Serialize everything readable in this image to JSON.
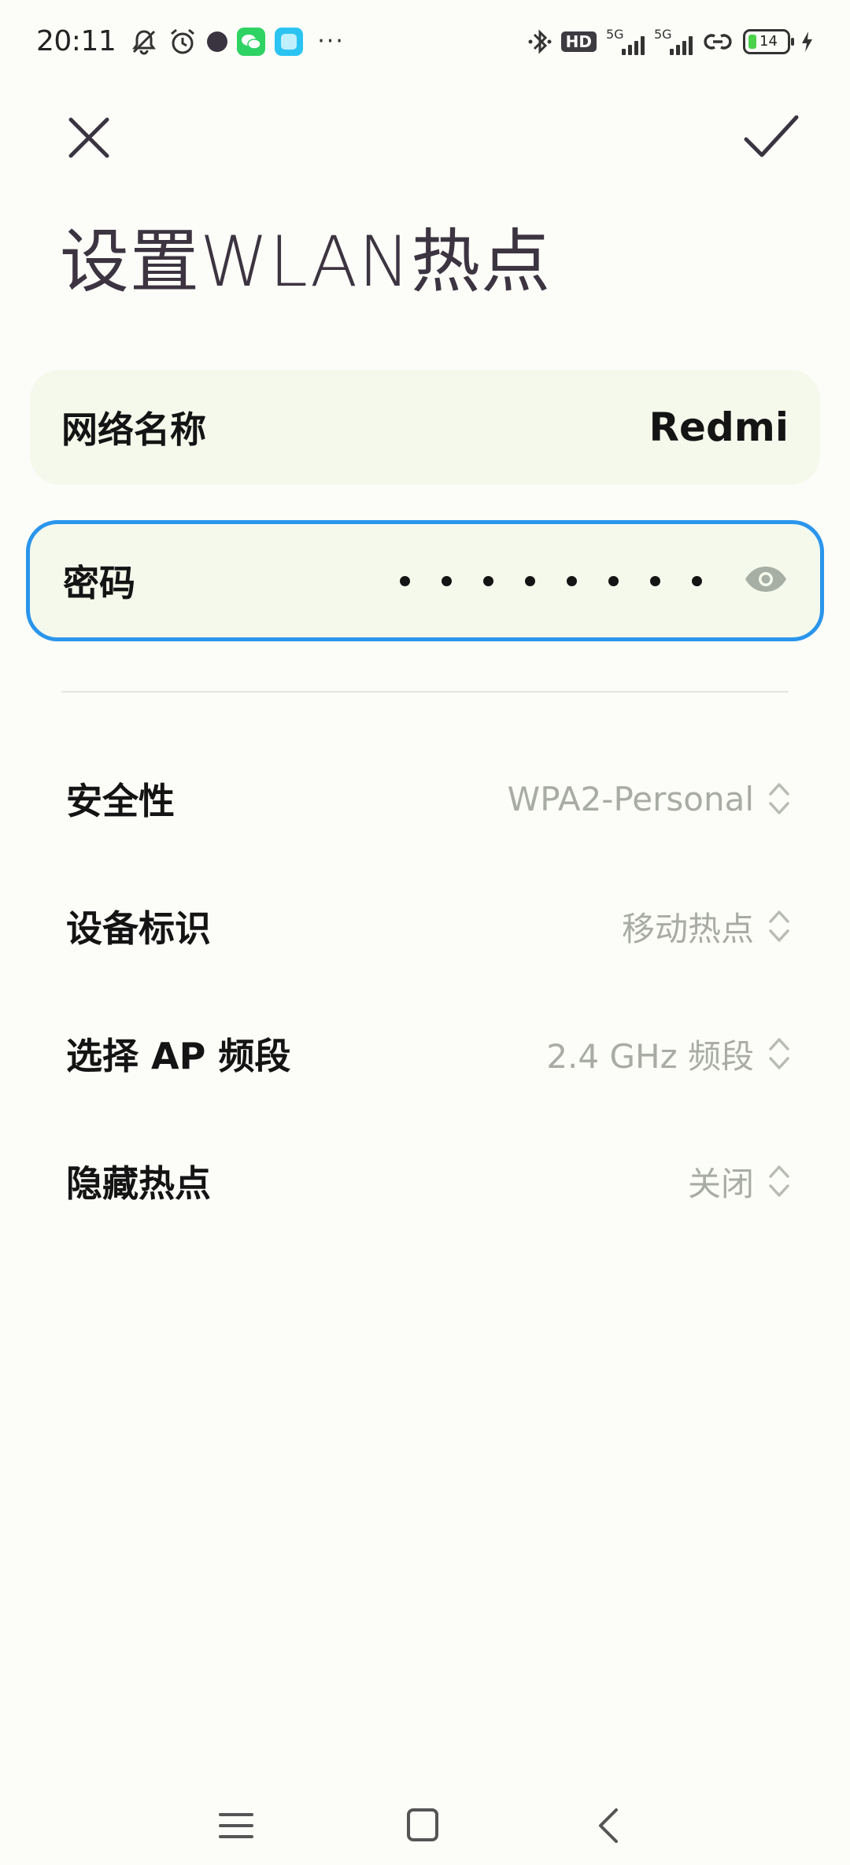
{
  "status_bar": {
    "time": "20:11",
    "icons": [
      "bell-muted-icon",
      "alarm-icon",
      "dark-dot-icon",
      "wechat-icon",
      "blue-app-icon"
    ],
    "more": "···",
    "hd_badge": "HD",
    "signal_label_1": "5G",
    "signal_label_2": "5G",
    "battery_level": "14"
  },
  "header": {
    "title": "设置WLAN热点"
  },
  "form": {
    "network_name_label": "网络名称",
    "network_name_value": "Redmi",
    "password_label": "密码",
    "password_masked_length": 8
  },
  "settings": [
    {
      "label": "安全性",
      "value": "WPA2-Personal"
    },
    {
      "label": "设备标识",
      "value": "移动热点"
    },
    {
      "label": "选择 AP 频段",
      "value": "2.4 GHz 频段"
    },
    {
      "label": "隐藏热点",
      "value": "关闭"
    }
  ],
  "colors": {
    "accent_border": "#2a95ec",
    "field_bg": "#f4f9ec",
    "page_bg": "#fcfcf8",
    "value_gray": "#a8aca4"
  }
}
